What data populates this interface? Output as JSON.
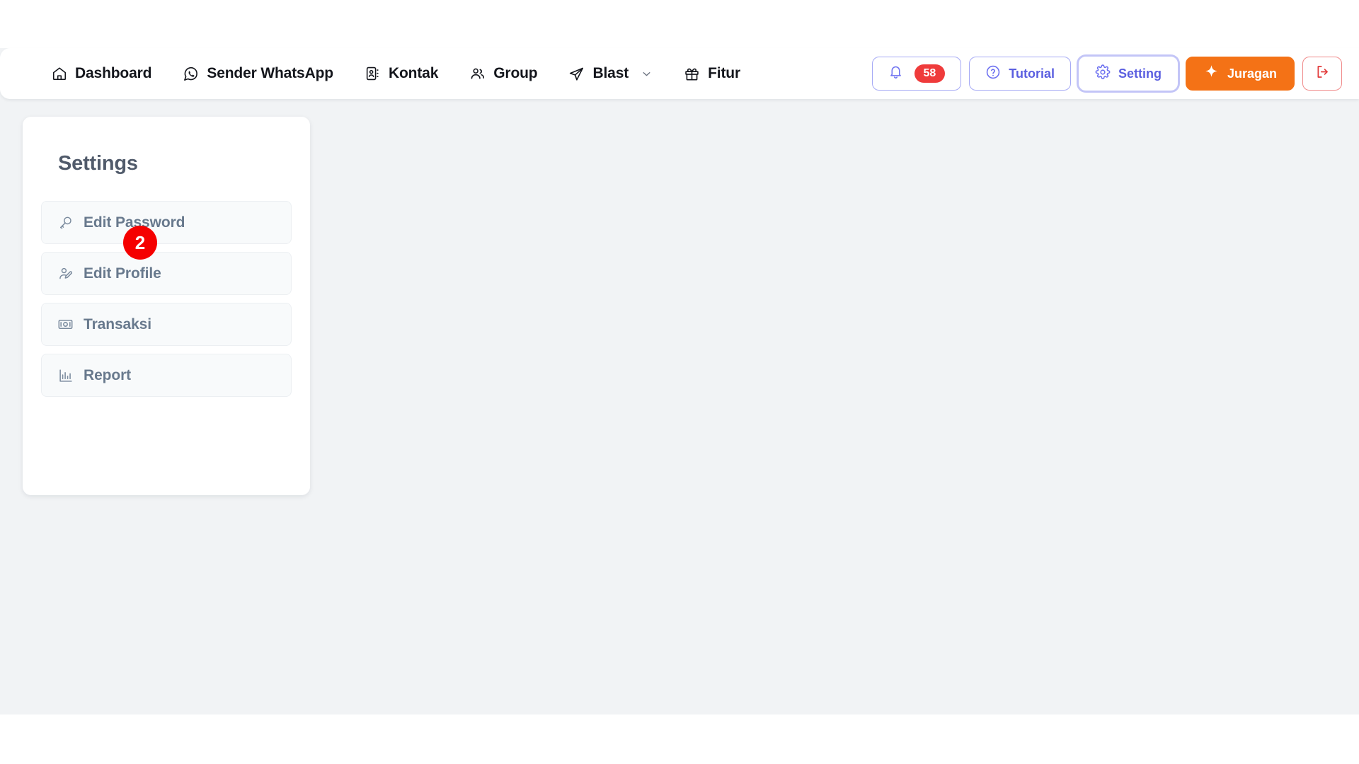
{
  "navbar": {
    "items": [
      {
        "label": "Dashboard",
        "icon": "home-icon",
        "has_caret": false
      },
      {
        "label": "Sender WhatsApp",
        "icon": "whatsapp-icon",
        "has_caret": false
      },
      {
        "label": "Kontak",
        "icon": "contact-book-icon",
        "has_caret": false
      },
      {
        "label": "Group",
        "icon": "users-group-icon",
        "has_caret": false
      },
      {
        "label": "Blast",
        "icon": "paper-plane-icon",
        "has_caret": true
      },
      {
        "label": "Fitur",
        "icon": "gift-icon",
        "has_caret": false
      }
    ],
    "actions": {
      "notification": {
        "icon": "bell-icon",
        "badge": "58"
      },
      "tutorial": {
        "label": "Tutorial",
        "icon": "question-circle-icon"
      },
      "setting": {
        "label": "Setting",
        "icon": "gear-icon",
        "focused": true
      },
      "juragan": {
        "label": "Juragan",
        "icon": "star-icon"
      },
      "logout": {
        "icon": "logout-icon"
      }
    }
  },
  "settings_card": {
    "title": "Settings",
    "items": [
      {
        "label": "Edit Password",
        "icon": "key-icon"
      },
      {
        "label": "Edit Profile",
        "icon": "user-edit-icon"
      },
      {
        "label": "Transaksi",
        "icon": "banknote-icon"
      },
      {
        "label": "Report",
        "icon": "bar-chart-icon"
      }
    ]
  },
  "step_marker": {
    "number": "2"
  },
  "colors": {
    "accent_orange": "#f47216",
    "accent_indigo": "#5b5fe0",
    "badge_red": "#ef3b3b",
    "marker_red": "#f50000",
    "page_bg": "#f1f3f5"
  }
}
